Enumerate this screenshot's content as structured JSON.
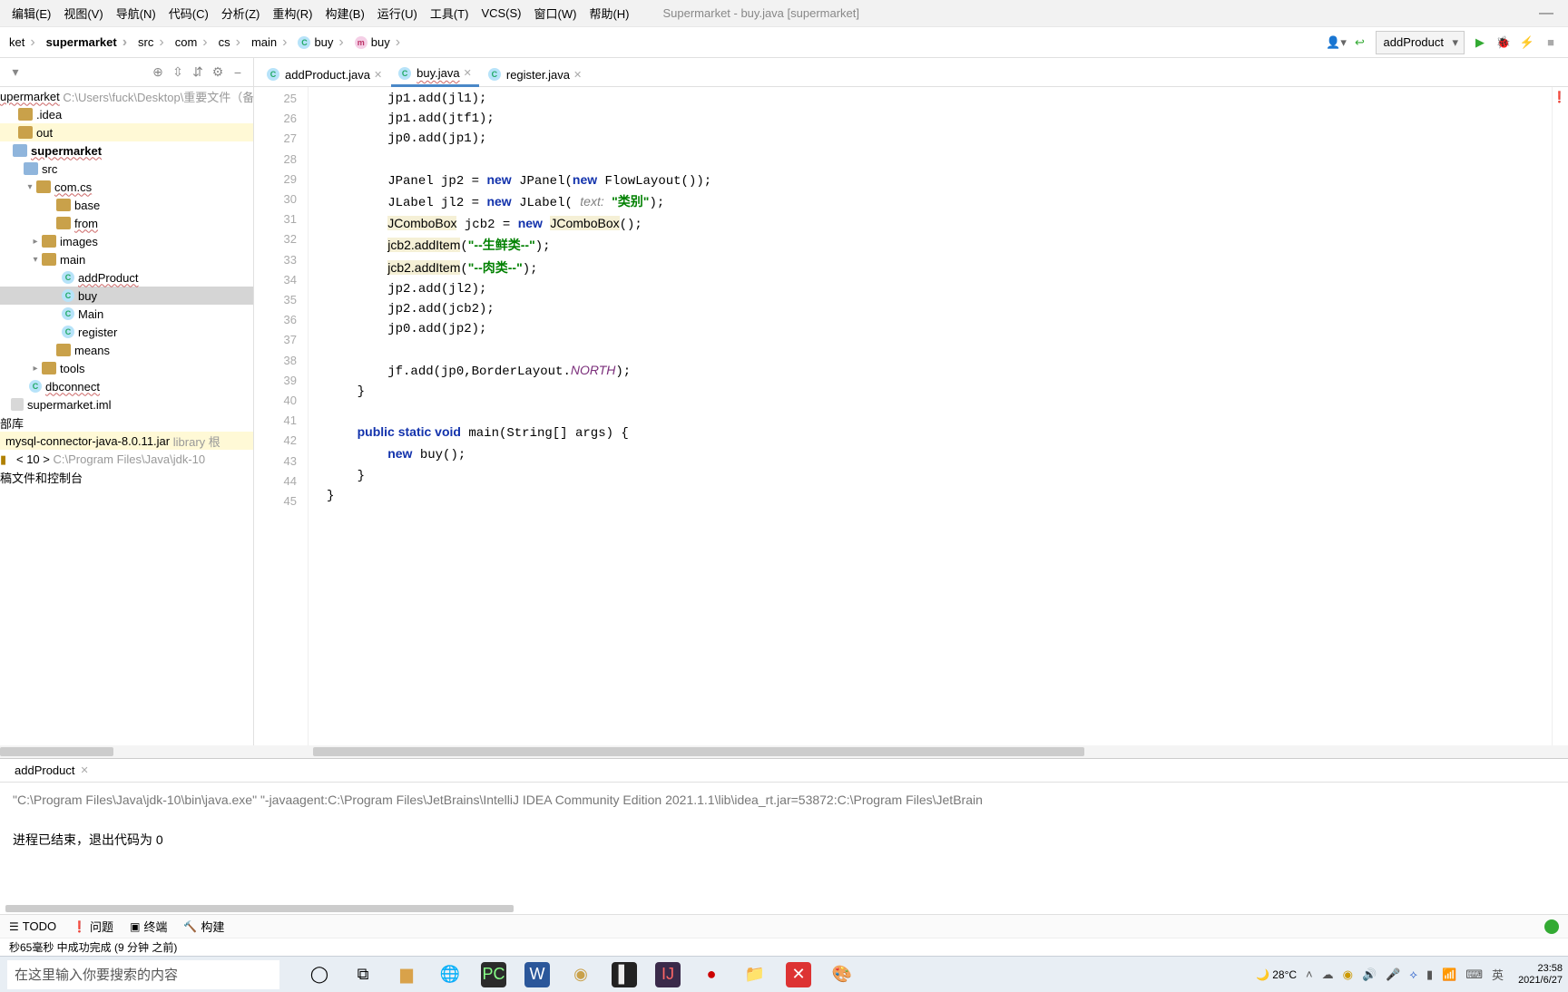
{
  "window": {
    "title": "Supermarket - buy.java [supermarket]"
  },
  "menu": {
    "edit": "编辑(E)",
    "view": "视图(V)",
    "nav": "导航(N)",
    "code": "代码(C)",
    "analyze": "分析(Z)",
    "refactor": "重构(R)",
    "build": "构建(B)",
    "run": "运行(U)",
    "tools": "工具(T)",
    "vcs": "VCS(S)",
    "window": "窗口(W)",
    "help": "帮助(H)"
  },
  "breadcrumb": [
    "ket",
    "supermarket",
    "src",
    "com",
    "cs",
    "main",
    "buy",
    "buy"
  ],
  "run_config": "addProduct",
  "toolbar_icons": [
    "add-user",
    "build-arrow"
  ],
  "proj_toolbar": {
    "dropdown": "▾",
    "target": "⊕",
    "collapse": "⇳",
    "expand": "⇵",
    "gear": "⚙",
    "minus": "−"
  },
  "tabs": [
    {
      "name": "addProduct.java",
      "active": false
    },
    {
      "name": "buy.java",
      "active": true
    },
    {
      "name": "register.java",
      "active": false
    }
  ],
  "tree": {
    "root": "upermarket",
    "root_path": "C:\\Users\\fuck\\Desktop\\重要文件（备",
    "idea": ".idea",
    "out": "out",
    "module": "supermarket",
    "src": "src",
    "pkg": "com.cs",
    "base": "base",
    "from": "from",
    "images": "images",
    "main": "main",
    "addProduct": "addProduct",
    "buy": "buy",
    "Main": "Main",
    "register": "register",
    "means": "means",
    "tools": "tools",
    "dbconnect": "dbconnect",
    "iml": "supermarket.iml",
    "extlib": "部库",
    "mysql": "mysql-connector-java-8.0.11.jar",
    "mysql_suffix": "library 根",
    "jdk": "< 10 >",
    "jdk_path": "C:\\Program Files\\Java\\jdk-10",
    "scratch": "稿文件和控制台"
  },
  "gutter": {
    "start": 25,
    "end": 45,
    "run_marker_line": 41
  },
  "code": {
    "l25": "        jp1.add(jl1);",
    "l26": "        jp1.add(jtf1);",
    "l27": "        jp0.add(jp1);",
    "l28": "",
    "l29a": "        JPanel jp2 = ",
    "l29b": "new",
    "l29c": " JPanel(",
    "l29d": "new",
    "l29e": " FlowLayout());",
    "l30a": "        JLabel jl2 = ",
    "l30b": "new",
    "l30c": " JLabel( ",
    "l30p": "text:",
    "l30d": " ",
    "l30s": "\"类别\"",
    "l30e": ");",
    "l31a": "        ",
    "l31w1": "JComboBox",
    "l31b": " jcb2 = ",
    "l31c": "new",
    "l31d": " ",
    "l31w2": "JComboBox",
    "l31e": "();",
    "l32a": "        ",
    "l32w": "jcb2.addItem",
    "l32b": "(",
    "l32s": "\"--生鲜类--\"",
    "l32c": ");",
    "l33a": "        ",
    "l33w": "jcb2.addItem",
    "l33b": "(",
    "l33s": "\"--肉类--\"",
    "l33c": ");",
    "l34": "        jp2.add(jl2);",
    "l35": "        jp2.add(jcb2);",
    "l36": "        jp0.add(jp2);",
    "l37": "",
    "l38a": "        jf.add(jp0,BorderLayout.",
    "l38b": "NORTH",
    "l38c": ");",
    "l39": "    }",
    "l40": "",
    "l41a": "    ",
    "l41b": "public static void",
    "l41c": " main(String[] args) {",
    "l42a": "        ",
    "l42b": "new",
    "l42c": " buy();",
    "l43": "    }",
    "l44": "}",
    "l45": ""
  },
  "error_count": "1",
  "console": {
    "tab": "addProduct",
    "line1": "\"C:\\Program Files\\Java\\jdk-10\\bin\\java.exe\" \"-javaagent:C:\\Program Files\\JetBrains\\IntelliJ IDEA Community Edition 2021.1.1\\lib\\idea_rt.jar=53872:C:\\Program Files\\JetBrain",
    "line2": "进程已结束，退出代码为 0"
  },
  "bottom_tools": {
    "todo": "TODO",
    "problems": "问题",
    "terminal": "终端",
    "build": "构建"
  },
  "status": "秒65毫秒 中成功完成 (9 分钟 之前)",
  "taskbar": {
    "search_placeholder": "在这里输入你要搜索的内容",
    "weather": "28°C",
    "ime": "英",
    "time": "23:58",
    "date": "2021/6/27"
  }
}
